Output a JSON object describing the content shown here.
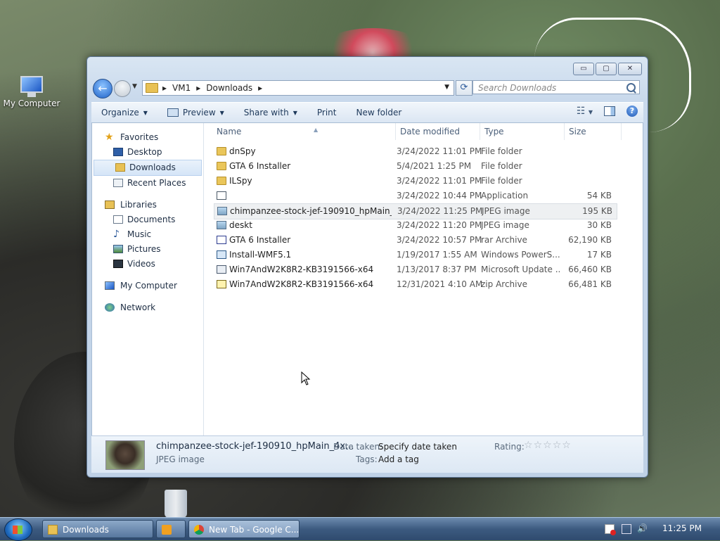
{
  "desktop": {
    "my_computer_label": "My Computer"
  },
  "window": {
    "caption_buttons": {
      "minimize": "▭",
      "maximize": "▢",
      "close": "✕"
    },
    "address": {
      "segments": [
        "VM1",
        "Downloads"
      ],
      "separator": "▸"
    },
    "search_placeholder": "Search Downloads",
    "toolbar": {
      "organize": "Organize",
      "preview": "Preview",
      "share_with": "Share with",
      "print": "Print",
      "new_folder": "New folder"
    },
    "nav": {
      "favorites": "Favorites",
      "desktop": "Desktop",
      "downloads": "Downloads",
      "recent_places": "Recent Places",
      "libraries": "Libraries",
      "documents": "Documents",
      "music": "Music",
      "pictures": "Pictures",
      "videos": "Videos",
      "my_computer": "My Computer",
      "network": "Network"
    },
    "columns": {
      "name": "Name",
      "date": "Date modified",
      "type": "Type",
      "size": "Size"
    },
    "files": [
      {
        "name": "dnSpy",
        "date": "3/24/2022 11:01 PM",
        "type": "File folder",
        "size": "",
        "icon": "folder-icon"
      },
      {
        "name": "GTA 6 Installer",
        "date": "5/4/2021 1:25 PM",
        "type": "File folder",
        "size": "",
        "icon": "folder-icon"
      },
      {
        "name": "ILSpy",
        "date": "3/24/2022 11:01 PM",
        "type": "File folder",
        "size": "",
        "icon": "folder-icon"
      },
      {
        "name": "",
        "date": "3/24/2022 10:44 PM",
        "type": "Application",
        "size": "54 KB",
        "icon": "application-icon"
      },
      {
        "name": "chimpanzee-stock-jef-190910_hpMain_4...",
        "date": "3/24/2022 11:25 PM",
        "type": "JPEG image",
        "size": "195 KB",
        "icon": "image-icon"
      },
      {
        "name": "deskt",
        "date": "3/24/2022 11:20 PM",
        "type": "JPEG image",
        "size": "30 KB",
        "icon": "image-icon"
      },
      {
        "name": "GTA 6 Installer",
        "date": "3/24/2022 10:57 PM",
        "type": "rar Archive",
        "size": "62,190 KB",
        "icon": "rar-icon"
      },
      {
        "name": "Install-WMF5.1",
        "date": "1/19/2017 1:55 AM",
        "type": "Windows PowerS...",
        "size": "17 KB",
        "icon": "powershell-icon"
      },
      {
        "name": "Win7AndW2K8R2-KB3191566-x64",
        "date": "1/13/2017 8:37 PM",
        "type": "Microsoft Update ...",
        "size": "66,460 KB",
        "icon": "update-icon"
      },
      {
        "name": "Win7AndW2K8R2-KB3191566-x64",
        "date": "12/31/2021 4:10 AM",
        "type": "zip Archive",
        "size": "66,481 KB",
        "icon": "zip-icon"
      }
    ],
    "details": {
      "filename": "chimpanzee-stock-jef-190910_hpMain_4x...",
      "filetype": "JPEG image",
      "date_taken_label": "Date taken:",
      "date_taken_value": "Specify date taken",
      "tags_label": "Tags:",
      "tags_value": "Add a tag",
      "rating_label": "Rating:",
      "rating_stars": 0
    }
  },
  "taskbar": {
    "tasks": [
      {
        "label": "Downloads"
      },
      {
        "label": ""
      },
      {
        "label": "New Tab - Google C..."
      }
    ],
    "clock": "11:25 PM"
  },
  "colors": {
    "accent": "#1e57b4",
    "selection": "#d5e5f7",
    "taskbar": "#3c5a80"
  }
}
